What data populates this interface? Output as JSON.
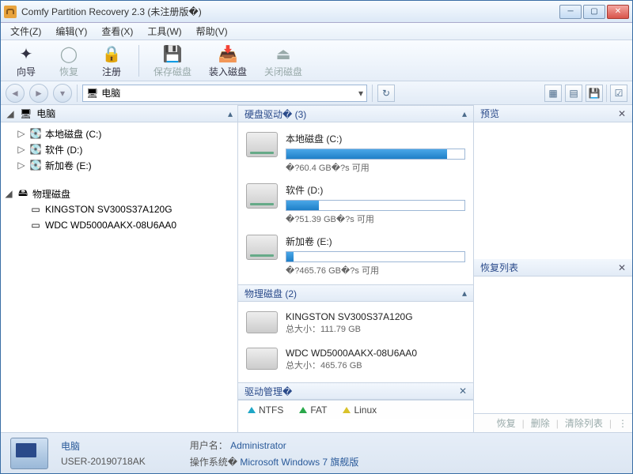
{
  "window": {
    "title": "Comfy Partition Recovery 2.3 (未注册版�)"
  },
  "menubar": [
    "文件(Z)",
    "编辑(Y)",
    "查看(X)",
    "工具(W)",
    "帮助(V)"
  ],
  "toolbar": {
    "wizard": "向导",
    "recover": "恢复",
    "register": "注册",
    "save_disk": "保存磁盘",
    "load_disk": "装入磁盘",
    "close_disk": "关闭磁盘"
  },
  "address": {
    "label": "电脑"
  },
  "sidebar": {
    "root": "电脑",
    "volumes": [
      {
        "label": "本地磁盘 (C:)"
      },
      {
        "label": "软件 (D:)"
      },
      {
        "label": "新加卷 (E:)"
      }
    ],
    "physical_header": "物理磁盘",
    "physical": [
      {
        "label": "KINGSTON SV300S37A120G"
      },
      {
        "label": "WDC WD5000AAKX-08U6AA0"
      }
    ]
  },
  "mid": {
    "hdd_header": "硬盘驱动� (3)",
    "drives": [
      {
        "name": "本地磁盘 (C:)",
        "free": "�?60.4 GB�?s 可用",
        "pct": 90
      },
      {
        "name": "软件 (D:)",
        "free": "�?51.39 GB�?s 可用",
        "pct": 18
      },
      {
        "name": "新加卷 (E:)",
        "free": "�?465.76 GB�?s 可用",
        "pct": 4
      }
    ],
    "phys_header": "物理磁盘 (2)",
    "physical": [
      {
        "name": "KINGSTON SV300S37A120G",
        "size": "总大小：111.79 GB"
      },
      {
        "name": "WDC WD5000AAKX-08U6AA0",
        "size": "总大小：465.76 GB"
      }
    ],
    "drivemgr_header": "驱动管理�",
    "fs": {
      "ntfs": "NTFS",
      "fat": "FAT",
      "linux": "Linux"
    }
  },
  "right": {
    "preview": "预览",
    "recovery_list": "恢复列表",
    "actions": {
      "recover": "恢复",
      "delete": "删除",
      "clear": "清除列表"
    }
  },
  "status": {
    "computer_label": "电脑",
    "computer_name": "USER-20190718AK",
    "user_label": "用户名：",
    "user_value": "Administrator",
    "os_label": "操作系统�",
    "os_value": "Microsoft Windows 7 旗舰版"
  }
}
